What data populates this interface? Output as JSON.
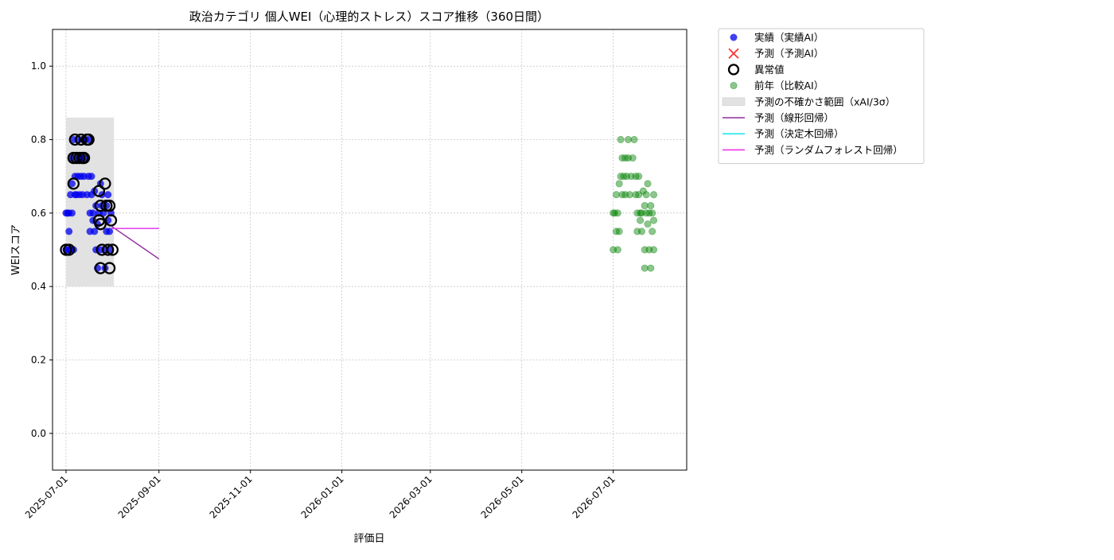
{
  "chart_data": {
    "type": "scatter",
    "title": "政治カテゴリ 個人WEI（心理的ストレス）スコア推移（360日間）",
    "xlabel": "評価日",
    "ylabel": "WEIスコア",
    "xlim": [
      "2025-06-22",
      "2026-08-19"
    ],
    "ylim": [
      -0.1,
      1.1
    ],
    "y_ticks": [
      0.0,
      0.2,
      0.4,
      0.6,
      0.8,
      1.0
    ],
    "y_tick_labels": [
      "0.0",
      "0.2",
      "0.4",
      "0.6",
      "0.8",
      "1.0"
    ],
    "x_ticks": [
      "2025-07-01",
      "2025-09-01",
      "2025-11-01",
      "2026-01-01",
      "2026-03-01",
      "2026-05-01",
      "2026-07-01"
    ],
    "grid": true,
    "legend_position": "outside-right-top",
    "colors": {
      "actual": "#0000ee",
      "forecast_marker": "#ff3333",
      "anomaly_edge": "#000000",
      "previous_year": "#008000",
      "uncertainty_band": "#e2e2e2",
      "linear": "#8e2c9e",
      "decision_tree": "#22e6ee",
      "random_forest": "#ee33ee"
    },
    "uncertainty_band": {
      "x_start": "2025-07-01",
      "x_end": "2025-08-02",
      "y_low": 0.4,
      "y_high": 0.86
    },
    "series": [
      {
        "name": "実績（実績AI）",
        "kind": "scatter",
        "points": [
          [
            "2025-07-01",
            0.5
          ],
          [
            "2025-07-01",
            0.6
          ],
          [
            "2025-07-02",
            0.5
          ],
          [
            "2025-07-02",
            0.6
          ],
          [
            "2025-07-03",
            0.55
          ],
          [
            "2025-07-03",
            0.6
          ],
          [
            "2025-07-04",
            0.5
          ],
          [
            "2025-07-04",
            0.65
          ],
          [
            "2025-07-05",
            0.6
          ],
          [
            "2025-07-05",
            0.68
          ],
          [
            "2025-07-05",
            0.75
          ],
          [
            "2025-07-06",
            0.5
          ],
          [
            "2025-07-06",
            0.8
          ],
          [
            "2025-07-07",
            0.7
          ],
          [
            "2025-07-07",
            0.65
          ],
          [
            "2025-07-08",
            0.75
          ],
          [
            "2025-07-08",
            0.65
          ],
          [
            "2025-07-09",
            0.8
          ],
          [
            "2025-07-09",
            0.7
          ],
          [
            "2025-07-10",
            0.75
          ],
          [
            "2025-07-10",
            0.65
          ],
          [
            "2025-07-11",
            0.7
          ],
          [
            "2025-07-11",
            0.75
          ],
          [
            "2025-07-12",
            0.8
          ],
          [
            "2025-07-12",
            0.65
          ],
          [
            "2025-07-13",
            0.7
          ],
          [
            "2025-07-13",
            0.75
          ],
          [
            "2025-07-14",
            0.8
          ],
          [
            "2025-07-15",
            0.65
          ],
          [
            "2025-07-16",
            0.7
          ],
          [
            "2025-07-16",
            0.8
          ],
          [
            "2025-07-17",
            0.6
          ],
          [
            "2025-07-17",
            0.55
          ],
          [
            "2025-07-18",
            0.65
          ],
          [
            "2025-07-18",
            0.7
          ],
          [
            "2025-07-19",
            0.58
          ],
          [
            "2025-07-19",
            0.6
          ],
          [
            "2025-07-20",
            0.66
          ],
          [
            "2025-07-20",
            0.55
          ],
          [
            "2025-07-21",
            0.62
          ],
          [
            "2025-07-21",
            0.5
          ],
          [
            "2025-07-22",
            0.57
          ],
          [
            "2025-07-22",
            0.45
          ],
          [
            "2025-07-23",
            0.6
          ],
          [
            "2025-07-24",
            0.68
          ],
          [
            "2025-07-24",
            0.5
          ],
          [
            "2025-07-25",
            0.62
          ],
          [
            "2025-07-25",
            0.65
          ],
          [
            "2025-07-26",
            0.6
          ],
          [
            "2025-07-27",
            0.5
          ],
          [
            "2025-07-27",
            0.45
          ],
          [
            "2025-07-28",
            0.62
          ],
          [
            "2025-07-28",
            0.55
          ],
          [
            "2025-07-29",
            0.58
          ],
          [
            "2025-07-29",
            0.65
          ],
          [
            "2025-07-30",
            0.5
          ],
          [
            "2025-07-30",
            0.55
          ],
          [
            "2025-07-31",
            0.6
          ]
        ]
      },
      {
        "name": "予測（予測AI）",
        "kind": "scatter-x",
        "points": []
      },
      {
        "name": "異常値",
        "kind": "ring",
        "points": [
          [
            "2025-07-01",
            0.5
          ],
          [
            "2025-07-03",
            0.5
          ],
          [
            "2025-07-06",
            0.68
          ],
          [
            "2025-07-06",
            0.75
          ],
          [
            "2025-07-07",
            0.8
          ],
          [
            "2025-07-08",
            0.75
          ],
          [
            "2025-07-10",
            0.75
          ],
          [
            "2025-07-11",
            0.8
          ],
          [
            "2025-07-12",
            0.75
          ],
          [
            "2025-07-13",
            0.75
          ],
          [
            "2025-07-15",
            0.8
          ],
          [
            "2025-07-16",
            0.8
          ],
          [
            "2025-07-23",
            0.66
          ],
          [
            "2025-07-23",
            0.58
          ],
          [
            "2025-07-24",
            0.62
          ],
          [
            "2025-07-24",
            0.57
          ],
          [
            "2025-07-24",
            0.45
          ],
          [
            "2025-07-25",
            0.5
          ],
          [
            "2025-07-27",
            0.68
          ],
          [
            "2025-07-28",
            0.62
          ],
          [
            "2025-07-29",
            0.5
          ],
          [
            "2025-07-30",
            0.45
          ],
          [
            "2025-07-30",
            0.62
          ],
          [
            "2025-07-31",
            0.58
          ],
          [
            "2025-08-01",
            0.5
          ]
        ]
      },
      {
        "name": "前年（比較AI）",
        "kind": "scatter-faded",
        "points": [
          [
            "2026-07-01",
            0.6
          ],
          [
            "2026-07-01",
            0.5
          ],
          [
            "2026-07-02",
            0.6
          ],
          [
            "2026-07-03",
            0.55
          ],
          [
            "2026-07-03",
            0.65
          ],
          [
            "2026-07-04",
            0.5
          ],
          [
            "2026-07-04",
            0.6
          ],
          [
            "2026-07-05",
            0.55
          ],
          [
            "2026-07-05",
            0.68
          ],
          [
            "2026-07-06",
            0.8
          ],
          [
            "2026-07-06",
            0.7
          ],
          [
            "2026-07-07",
            0.75
          ],
          [
            "2026-07-07",
            0.65
          ],
          [
            "2026-07-08",
            0.7
          ],
          [
            "2026-07-09",
            0.75
          ],
          [
            "2026-07-09",
            0.65
          ],
          [
            "2026-07-10",
            0.7
          ],
          [
            "2026-07-11",
            0.8
          ],
          [
            "2026-07-11",
            0.75
          ],
          [
            "2026-07-12",
            0.65
          ],
          [
            "2026-07-13",
            0.7
          ],
          [
            "2026-07-14",
            0.75
          ],
          [
            "2026-07-15",
            0.8
          ],
          [
            "2026-07-16",
            0.65
          ],
          [
            "2026-07-16",
            0.7
          ],
          [
            "2026-07-17",
            0.6
          ],
          [
            "2026-07-17",
            0.55
          ],
          [
            "2026-07-18",
            0.65
          ],
          [
            "2026-07-18",
            0.7
          ],
          [
            "2026-07-19",
            0.6
          ],
          [
            "2026-07-19",
            0.58
          ],
          [
            "2026-07-20",
            0.55
          ],
          [
            "2026-07-20",
            0.6
          ],
          [
            "2026-07-21",
            0.66
          ],
          [
            "2026-07-22",
            0.5
          ],
          [
            "2026-07-22",
            0.45
          ],
          [
            "2026-07-22",
            0.62
          ],
          [
            "2026-07-23",
            0.65
          ],
          [
            "2026-07-23",
            0.6
          ],
          [
            "2026-07-24",
            0.68
          ],
          [
            "2026-07-24",
            0.57
          ],
          [
            "2026-07-25",
            0.6
          ],
          [
            "2026-07-25",
            0.5
          ],
          [
            "2026-07-26",
            0.62
          ],
          [
            "2026-07-26",
            0.45
          ],
          [
            "2026-07-27",
            0.6
          ],
          [
            "2026-07-27",
            0.55
          ],
          [
            "2026-07-28",
            0.58
          ],
          [
            "2026-07-28",
            0.65
          ],
          [
            "2026-07-28",
            0.5
          ]
        ]
      },
      {
        "name": "予測の不確かさ範囲（xAI/3σ）",
        "kind": "band",
        "points": []
      },
      {
        "name": "予測（線形回帰）",
        "kind": "line",
        "points": [
          [
            "2025-07-31",
            0.565
          ],
          [
            "2025-09-01",
            0.475
          ]
        ]
      },
      {
        "name": "予測（決定木回帰）",
        "kind": "line",
        "points": [
          [
            "2025-07-31",
            0.558
          ],
          [
            "2025-09-01",
            0.558
          ]
        ]
      },
      {
        "name": "予測（ランダムフォレスト回帰）",
        "kind": "line",
        "points": [
          [
            "2025-07-31",
            0.558
          ],
          [
            "2025-09-01",
            0.558
          ]
        ]
      }
    ]
  }
}
